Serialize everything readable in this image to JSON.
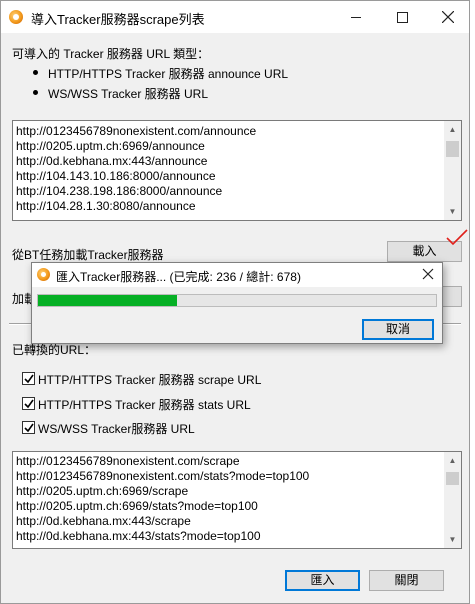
{
  "window": {
    "title": "導入Tracker服務器scrape列表"
  },
  "intro": {
    "heading": "可導入的 Tracker 服務器 URL 類型：",
    "types": [
      "HTTP/HTTPS Tracker 服務器 announce URL",
      "WS/WSS Tracker 服務器 URL"
    ]
  },
  "announce_list": {
    "lines": [
      "http://0123456789nonexistent.com/announce",
      "http://0205.uptm.ch:6969/announce",
      "http://0d.kebhana.mx:443/announce",
      "http://104.143.10.186:8000/announce",
      "http://104.238.198.186:8000/announce",
      "http://104.28.1.30:8080/announce"
    ]
  },
  "load_from_task": {
    "label": "從BT任務加載Tracker服務器",
    "button": "載入"
  },
  "second_row_label_partial": "加載",
  "converted": {
    "label": "已轉換的URL：",
    "options": [
      {
        "label": "HTTP/HTTPS Tracker 服務器 scrape URL",
        "checked": true
      },
      {
        "label": "HTTP/HTTPS Tracker 服務器 stats URL",
        "checked": true
      },
      {
        "label": "WS/WSS Tracker服務器 URL",
        "checked": true
      }
    ]
  },
  "converted_list": {
    "lines": [
      "http://0123456789nonexistent.com/scrape",
      "http://0123456789nonexistent.com/stats?mode=top100",
      "http://0205.uptm.ch:6969/scrape",
      "http://0205.uptm.ch:6969/stats?mode=top100",
      "http://0d.kebhana.mx:443/scrape",
      "http://0d.kebhana.mx:443/stats?mode=top100"
    ]
  },
  "footer": {
    "import_button": "匯入",
    "close_button": "關閉"
  },
  "progress_dialog": {
    "title": "匯入Tracker服務器... (已完成: 236 / 總計: 678)",
    "done": 236,
    "total": 678,
    "cancel_button": "取消"
  },
  "colors": {
    "progress_fill": "#06b025",
    "annotation_check": "#e0201b"
  }
}
